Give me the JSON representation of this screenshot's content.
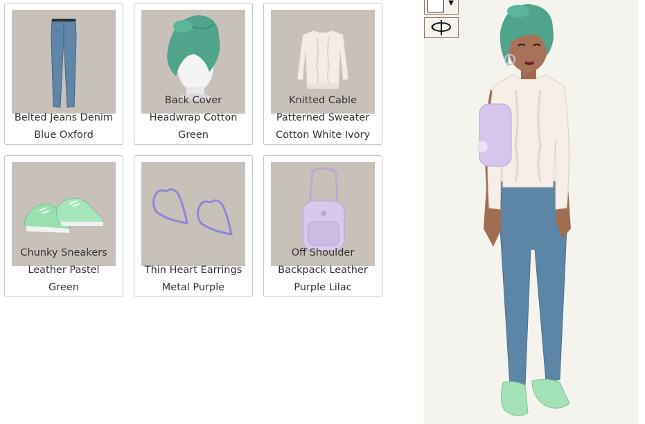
{
  "items": [
    {
      "name_lines": [
        "Belted Jeans Denim",
        "Blue Oxford"
      ],
      "overlay_line": "",
      "icon": "jeans-icon"
    },
    {
      "name_lines": [
        "Headwrap Cotton",
        "Green"
      ],
      "overlay_line": "Back Cover",
      "icon": "headwrap-icon"
    },
    {
      "name_lines": [
        "Patterned Sweater",
        "Cotton White Ivory"
      ],
      "overlay_line": "Knitted Cable",
      "icon": "sweater-icon"
    },
    {
      "name_lines": [
        "Leather Pastel",
        "Green"
      ],
      "overlay_line": "Chunky Sneakers",
      "icon": "sneakers-icon"
    },
    {
      "name_lines": [
        "Thin Heart Earrings",
        "Metal Purple"
      ],
      "overlay_line": "",
      "icon": "heart-earrings-icon"
    },
    {
      "name_lines": [
        "Backpack Leather",
        "Purple Lilac"
      ],
      "overlay_line": "Off Shoulder",
      "icon": "backpack-icon"
    }
  ],
  "preview": {
    "color_select": {
      "swatch_color": "#ffffff",
      "caret": "▼"
    },
    "rotate_icon": "rotate-icon",
    "avatar_icon": "avatar-figure",
    "background": "#f5f3ee"
  }
}
